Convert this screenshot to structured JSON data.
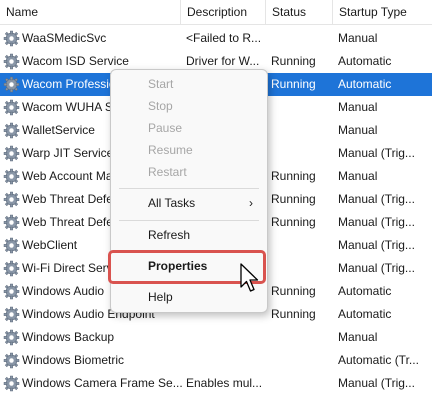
{
  "columns": {
    "name": "Name",
    "description": "Description",
    "status": "Status",
    "startup_type": "Startup Type"
  },
  "rows": [
    {
      "name": "WaaSMedicSvc",
      "description": "<Failed to R...",
      "status": "",
      "startup": "Manual"
    },
    {
      "name": "Wacom ISD Service",
      "description": "Driver for W...",
      "status": "Running",
      "startup": "Automatic"
    },
    {
      "name": "Wacom Professional Service",
      "description": "Driver for W...",
      "status": "Running",
      "startup": "Automatic"
    },
    {
      "name": "Wacom WUHA Service",
      "description": "",
      "status": "",
      "startup": "Manual"
    },
    {
      "name": "WalletService",
      "description": "",
      "status": "",
      "startup": "Manual"
    },
    {
      "name": "Warp JIT Service",
      "description": "",
      "status": "",
      "startup": "Manual (Trig..."
    },
    {
      "name": "Web Account Manager",
      "description": "",
      "status": "Running",
      "startup": "Manual"
    },
    {
      "name": "Web Threat Defense",
      "description": "",
      "status": "Running",
      "startup": "Manual (Trig..."
    },
    {
      "name": "Web Threat Defense User",
      "description": "",
      "status": "Running",
      "startup": "Manual (Trig..."
    },
    {
      "name": "WebClient",
      "description": "",
      "status": "",
      "startup": "Manual (Trig..."
    },
    {
      "name": "Wi-Fi Direct Services",
      "description": "",
      "status": "",
      "startup": "Manual (Trig..."
    },
    {
      "name": "Windows Audio",
      "description": "",
      "status": "Running",
      "startup": "Automatic"
    },
    {
      "name": "Windows Audio Endpoint",
      "description": "",
      "status": "Running",
      "startup": "Automatic"
    },
    {
      "name": "Windows Backup",
      "description": "",
      "status": "",
      "startup": "Manual"
    },
    {
      "name": "Windows Biometric",
      "description": "",
      "status": "",
      "startup": "Automatic (Tr..."
    },
    {
      "name": "Windows Camera Frame Se...",
      "description": "Enables mul...",
      "status": "",
      "startup": "Manual (Trig..."
    }
  ],
  "selected_row": 2,
  "context_menu": {
    "start": "Start",
    "stop": "Stop",
    "pause": "Pause",
    "resume": "Resume",
    "restart": "Restart",
    "all_tasks": "All Tasks",
    "all_tasks_arrow": "›",
    "refresh": "Refresh",
    "properties": "Properties",
    "help": "Help"
  },
  "colors": {
    "selection": "#1e74d8",
    "highlight_box": "#d9534f"
  },
  "icons": {
    "row_icon": "gear-icon",
    "cursor": "mouse-pointer-icon"
  }
}
